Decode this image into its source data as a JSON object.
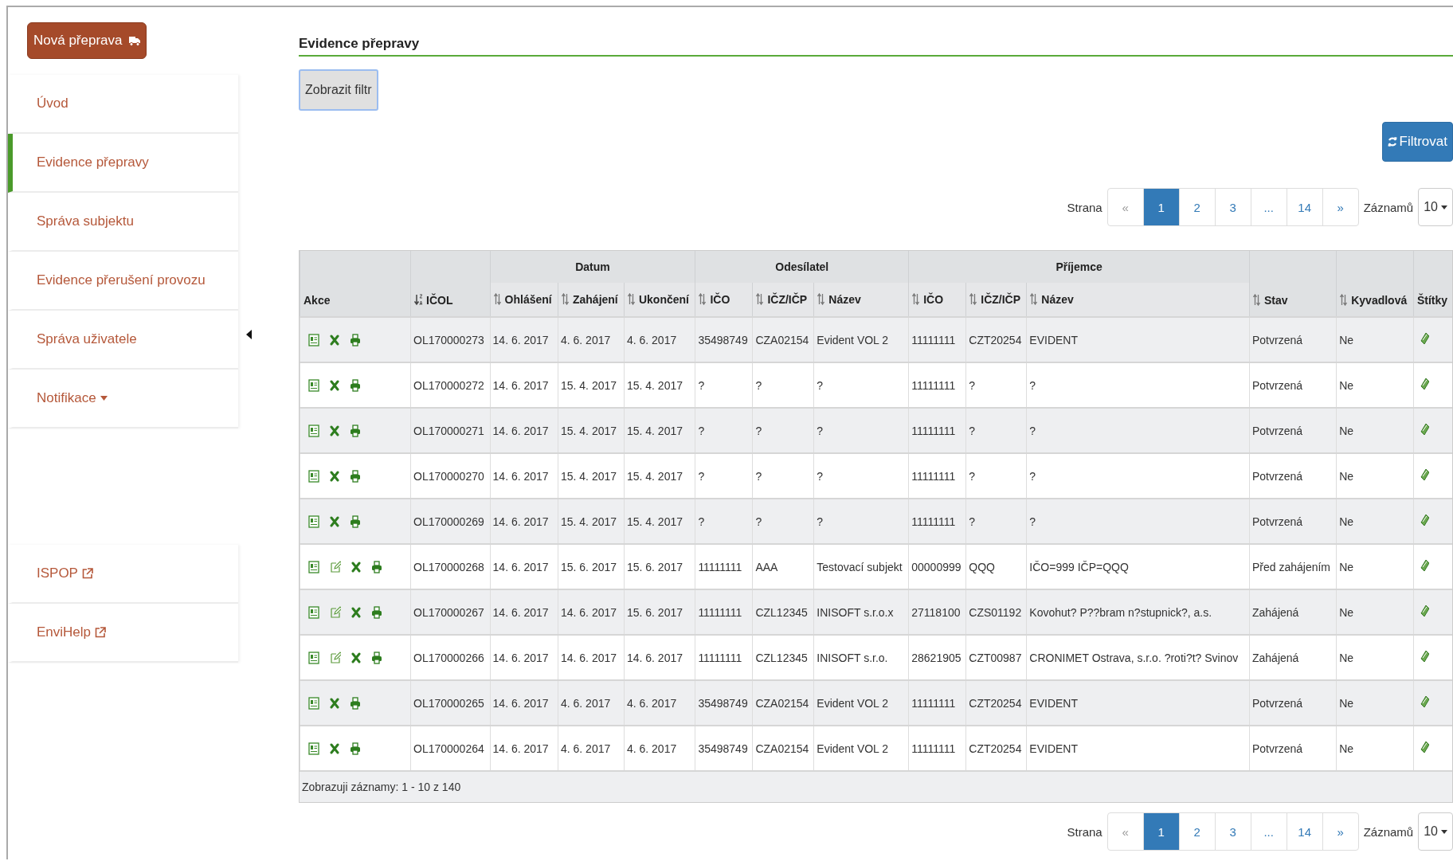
{
  "new_button": {
    "label": "Nová přeprava"
  },
  "sidebar": {
    "items": [
      {
        "label": "Úvod",
        "selected": false
      },
      {
        "label": "Evidence přepravy",
        "selected": true
      },
      {
        "label": "Správa subjektu",
        "selected": false
      },
      {
        "label": "Evidence přerušení provozu",
        "selected": false
      },
      {
        "label": "Správa uživatele",
        "selected": false
      },
      {
        "label": "Notifikace",
        "selected": false,
        "dropdown": true
      }
    ],
    "links": [
      {
        "label": "ISPOP",
        "external": true
      },
      {
        "label": "EnviHelp",
        "external": true
      }
    ]
  },
  "page_title": "Evidence přepravy",
  "filter_toggle": {
    "label": "Zobrazit filtr"
  },
  "filter_button": {
    "label": "Filtrovat"
  },
  "pagination_top": {
    "label": "Strana",
    "pages": [
      {
        "label": "«",
        "selected": false
      },
      {
        "label": "1",
        "selected": true
      },
      {
        "label": "2",
        "selected": false
      },
      {
        "label": "3",
        "selected": false
      },
      {
        "label": "...",
        "selected": false
      },
      {
        "label": "14",
        "selected": false
      },
      {
        "label": "»",
        "selected": false
      }
    ],
    "per_page_label": "Záznamů",
    "per_page": "10"
  },
  "table": {
    "header": [
      {
        "label": "Akce",
        "sortable": false
      },
      {
        "label": "IČOL",
        "sortable": true,
        "sorted_descending": true
      },
      {
        "group": "Datum",
        "columns": [
          {
            "label": "Ohlášení",
            "sortable": true
          },
          {
            "label": "Zahájení",
            "sortable": true
          },
          {
            "label": "Ukončení",
            "sortable": true
          }
        ]
      },
      {
        "group": "Odesílatel",
        "columns": [
          {
            "label": "IČO",
            "sortable": true
          },
          {
            "label": "IČZ/IČP",
            "sortable": true
          },
          {
            "label": "Název",
            "sortable": true
          }
        ]
      },
      {
        "group": "Příjemce",
        "columns": [
          {
            "label": "IČO",
            "sortable": true
          },
          {
            "label": "IČZ/IČP",
            "sortable": true
          },
          {
            "label": "Název",
            "sortable": true
          }
        ]
      },
      {
        "label": "Stav",
        "sortable": true
      },
      {
        "label": "Kyvadlová",
        "sortable": true
      },
      {
        "label": "Štítky",
        "sortable": false
      }
    ],
    "rows": [
      {
        "editable": false,
        "cells": [
          "OL170000273",
          "14. 6. 2017",
          "4. 6. 2017",
          "4. 6. 2017",
          "35498749",
          "CZA02154",
          "Evident VOL 2",
          "11111111",
          "CZT20254",
          "EVIDENT",
          "Potvrzená",
          "Ne"
        ]
      },
      {
        "editable": false,
        "cells": [
          "OL170000272",
          "14. 6. 2017",
          "15. 4. 2017",
          "15. 4. 2017",
          "?",
          "?",
          "?",
          "11111111",
          "?",
          "?",
          "Potvrzená",
          "Ne"
        ]
      },
      {
        "editable": false,
        "cells": [
          "OL170000271",
          "14. 6. 2017",
          "15. 4. 2017",
          "15. 4. 2017",
          "?",
          "?",
          "?",
          "11111111",
          "?",
          "?",
          "Potvrzená",
          "Ne"
        ]
      },
      {
        "editable": false,
        "cells": [
          "OL170000270",
          "14. 6. 2017",
          "15. 4. 2017",
          "15. 4. 2017",
          "?",
          "?",
          "?",
          "11111111",
          "?",
          "?",
          "Potvrzená",
          "Ne"
        ]
      },
      {
        "editable": false,
        "cells": [
          "OL170000269",
          "14. 6. 2017",
          "15. 4. 2017",
          "15. 4. 2017",
          "?",
          "?",
          "?",
          "11111111",
          "?",
          "?",
          "Potvrzená",
          "Ne"
        ]
      },
      {
        "editable": true,
        "cells": [
          "OL170000268",
          "14. 6. 2017",
          "15. 6. 2017",
          "15. 6. 2017",
          "11111111",
          "AAA",
          "Testovací subjekt",
          "00000999",
          "QQQ",
          "IČO=999 IČP=QQQ",
          "Před zahájením",
          "Ne"
        ]
      },
      {
        "editable": true,
        "cells": [
          "OL170000267",
          "14. 6. 2017",
          "14. 6. 2017",
          "15. 6. 2017",
          "11111111",
          "CZL12345",
          "INISOFT s.r.o.x",
          "27118100",
          "CZS01192",
          "Kovohut? P??bram n?stupnick?, a.s.",
          "Zahájená",
          "Ne"
        ]
      },
      {
        "editable": true,
        "cells": [
          "OL170000266",
          "14. 6. 2017",
          "14. 6. 2017",
          "14. 6. 2017",
          "11111111",
          "CZL12345",
          "INISOFT s.r.o.",
          "28621905",
          "CZT00987",
          "CRONIMET Ostrava, s.r.o. ?roti?t? Svinov",
          "Zahájená",
          "Ne"
        ]
      },
      {
        "editable": false,
        "cells": [
          "OL170000265",
          "14. 6. 2017",
          "4. 6. 2017",
          "4. 6. 2017",
          "35498749",
          "CZA02154",
          "Evident VOL 2",
          "11111111",
          "CZT20254",
          "EVIDENT",
          "Potvrzená",
          "Ne"
        ]
      },
      {
        "editable": false,
        "cells": [
          "OL170000264",
          "14. 6. 2017",
          "4. 6. 2017",
          "4. 6. 2017",
          "35498749",
          "CZA02154",
          "Evident VOL 2",
          "11111111",
          "CZT20254",
          "EVIDENT",
          "Potvrzená",
          "Ne"
        ]
      }
    ],
    "footer": "Zobrazuji záznamy: 1 - 10 z 140"
  },
  "pagination_bottom": {
    "label": "Strana",
    "pages": [
      {
        "label": "«",
        "selected": false
      },
      {
        "label": "1",
        "selected": true
      },
      {
        "label": "2",
        "selected": false
      },
      {
        "label": "3",
        "selected": false
      },
      {
        "label": "...",
        "selected": false
      },
      {
        "label": "14",
        "selected": false
      },
      {
        "label": "»",
        "selected": false
      }
    ],
    "per_page_label": "Záznamů",
    "per_page": "10"
  }
}
